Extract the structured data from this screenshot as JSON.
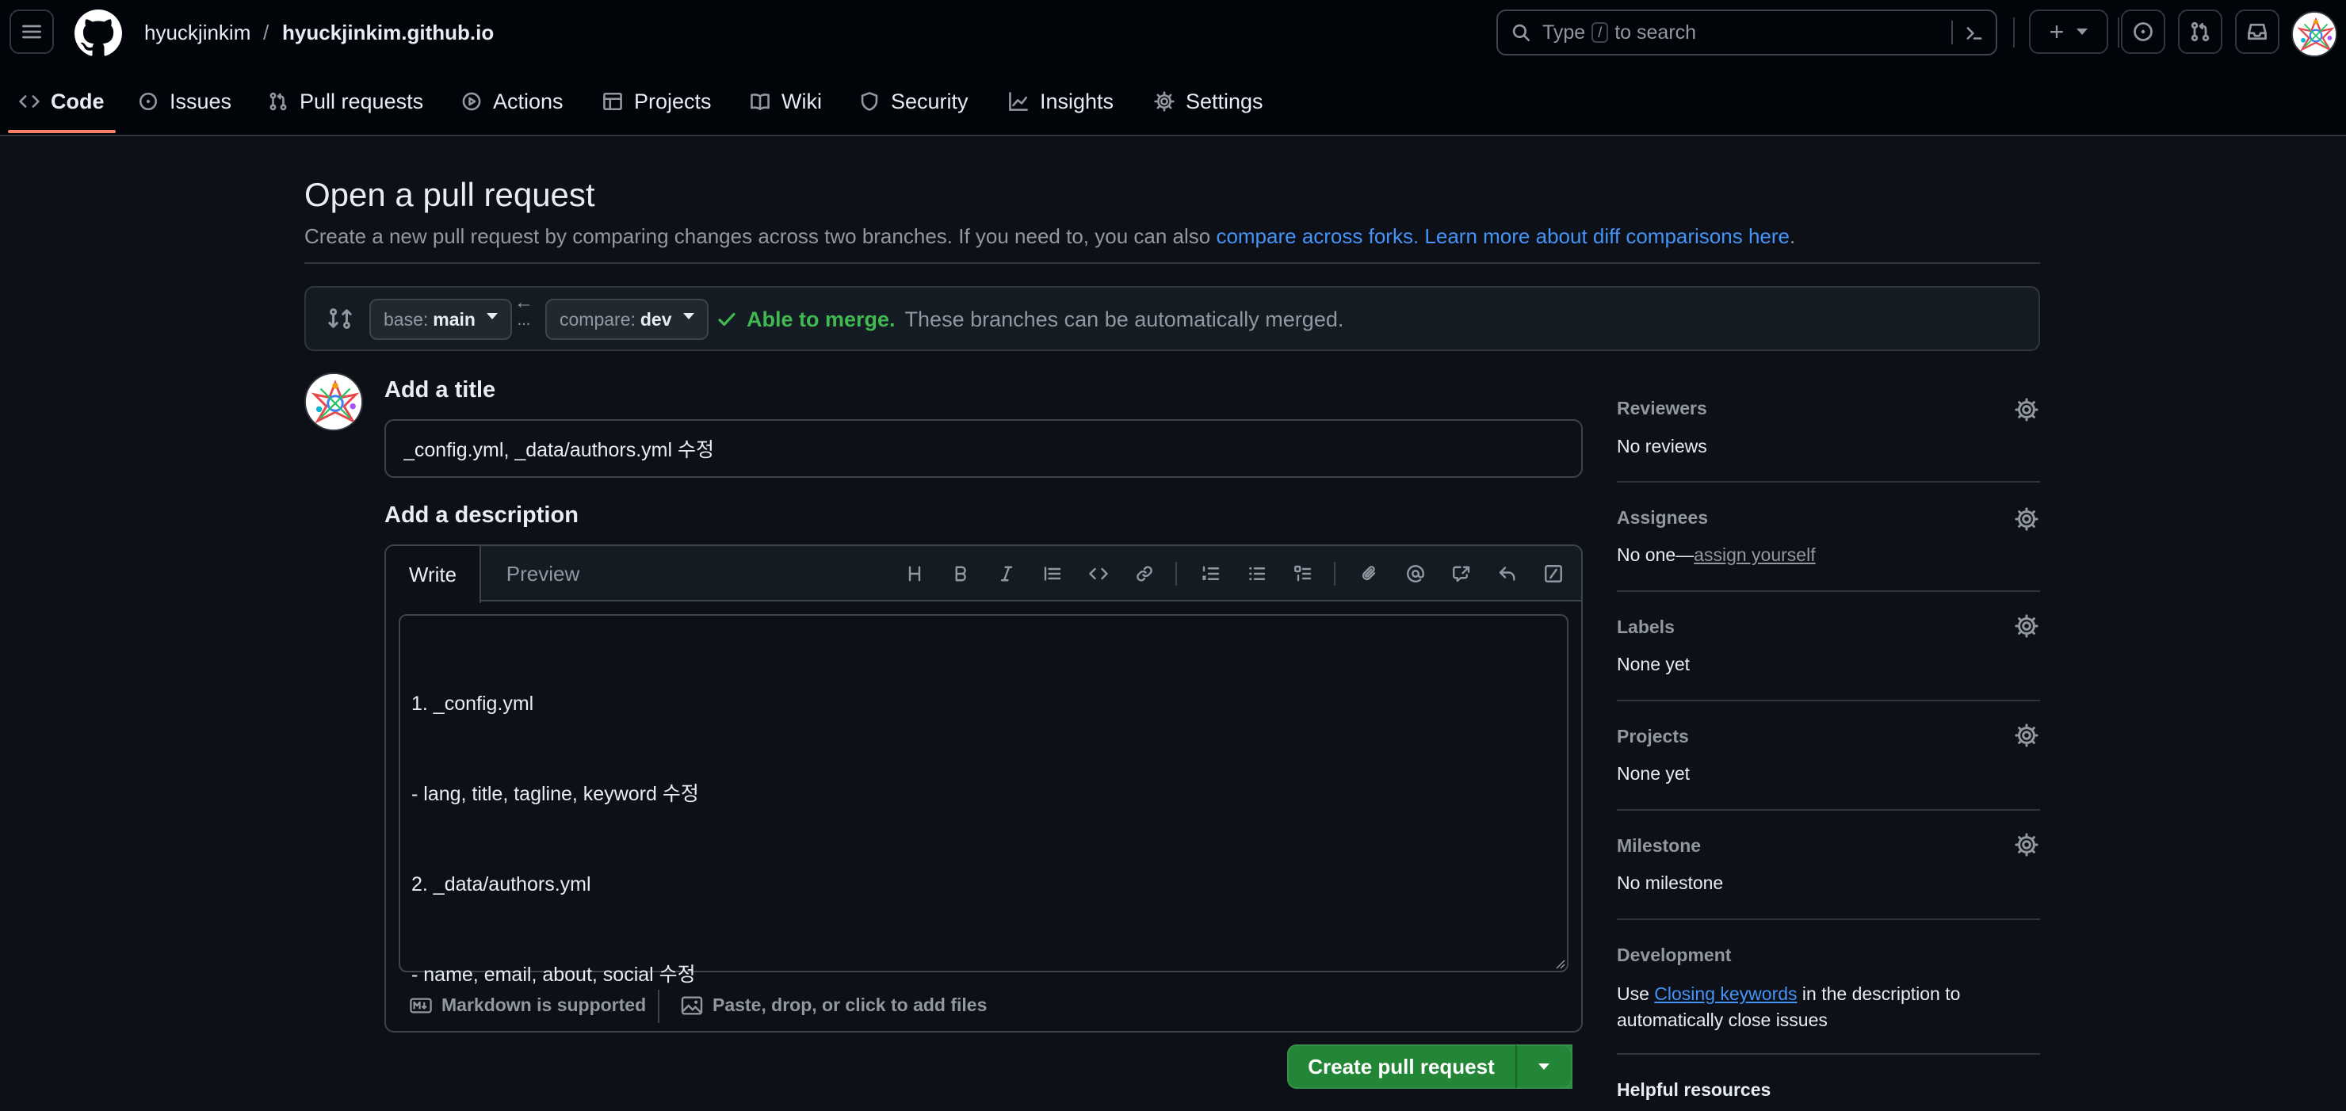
{
  "header": {
    "repo_owner": "hyuckjinkim",
    "repo_separator": "/",
    "repo_name": "hyuckjinkim.github.io",
    "search": {
      "prefix": "Type",
      "key": "/",
      "suffix": "to search"
    },
    "new_button_label": "+"
  },
  "tabs": [
    {
      "label": "Code",
      "icon": "code-icon",
      "selected": true
    },
    {
      "label": "Issues",
      "icon": "issue-icon"
    },
    {
      "label": "Pull requests",
      "icon": "pull-request-icon"
    },
    {
      "label": "Actions",
      "icon": "play-icon"
    },
    {
      "label": "Projects",
      "icon": "table-icon"
    },
    {
      "label": "Wiki",
      "icon": "book-icon"
    },
    {
      "label": "Security",
      "icon": "shield-icon"
    },
    {
      "label": "Insights",
      "icon": "graph-icon"
    },
    {
      "label": "Settings",
      "icon": "gear-icon"
    }
  ],
  "page": {
    "title": "Open a pull request",
    "subtitle_prefix": "Create a new pull request by comparing changes across two branches. If you need to, you can also ",
    "subtitle_link1": "compare across forks.",
    "subtitle_middle": " ",
    "subtitle_link2": "Learn more about diff comparisons here",
    "subtitle_suffix": "."
  },
  "compare": {
    "base_prefix": "base:",
    "base_branch": "main",
    "arrow": "←",
    "dots": "...",
    "compare_prefix": "compare:",
    "compare_branch": "dev",
    "merge_ok": "Able to merge.",
    "merge_msg": "These branches can be automatically merged."
  },
  "form": {
    "title_heading": "Add a title",
    "title_value": "_config.yml, _data/authors.yml 수정",
    "description_heading": "Add a description",
    "tab_write": "Write",
    "tab_preview": "Preview",
    "description_lines": [
      "1. _config.yml",
      "- lang, title, tagline, keyword 수정",
      "2. _data/authors.yml",
      "- name, email, about, social 수정"
    ],
    "markdown_note": "Markdown is supported",
    "attach_note": "Paste, drop, or click to add files",
    "create_button": "Create pull request"
  },
  "sidebar": {
    "reviewers": {
      "heading": "Reviewers",
      "value": "No reviews"
    },
    "assignees": {
      "heading": "Assignees",
      "value_prefix": "No one—",
      "link": "assign yourself"
    },
    "labels": {
      "heading": "Labels",
      "value": "None yet"
    },
    "projects": {
      "heading": "Projects",
      "value": "None yet"
    },
    "milestone": {
      "heading": "Milestone",
      "value": "No milestone"
    },
    "development": {
      "heading": "Development",
      "prefix": "Use ",
      "link": "Closing keywords",
      "suffix_line1": " in the description to",
      "line2": "automatically close issues"
    },
    "helpful": {
      "heading": "Helpful resources"
    }
  },
  "colors": {
    "accent_link": "#4493f8",
    "success": "#3fb950",
    "primary_button": "#238636",
    "tab_underline": "#f78166"
  }
}
